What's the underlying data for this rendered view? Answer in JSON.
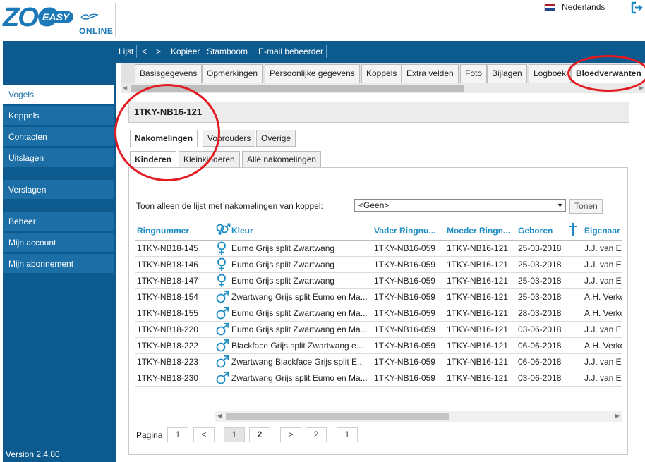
{
  "header": {
    "logo_zoo": "ZOO",
    "logo_easy": "EASY",
    "logo_online": "ONLINE",
    "language": "Nederlands"
  },
  "toolbar": [
    "Lijst",
    "<",
    ">",
    "Kopieer",
    "Stamboom",
    "E-mail beheerder"
  ],
  "sidebar": {
    "items": [
      "Vogels",
      "Koppels",
      "Contacten",
      "Uitslagen",
      "Verslagen",
      "Beheer",
      "Mijn account",
      "Mijn abonnement"
    ],
    "version": "Version 2.4.80"
  },
  "record_tabs": [
    "Basisgegevens",
    "Opmerkingen",
    "Persoonlijke gegevens",
    "Koppels",
    "Extra velden",
    "Foto",
    "Bijlagen",
    "Logboek",
    "Bloedverwanten"
  ],
  "record_title": "1TKY-NB16-121",
  "tabs_level1": [
    "Nakomelingen",
    "Voorouders",
    "Overige"
  ],
  "tabs_level2": [
    "Kinderen",
    "Kleinkinderen",
    "Alle nakomelingen"
  ],
  "filter": {
    "label": "Toon alleen de lijst met nakomelingen van koppel:",
    "value": "<Geen>",
    "button": "Tonen"
  },
  "table": {
    "headers": [
      "Ringnummer",
      "Kleur",
      "Vader Ringnu...",
      "Moeder Ringn...",
      "Geboren",
      "Eigenaar"
    ],
    "rows": [
      {
        "ring": "1TKY-NB18-145",
        "sex": "female",
        "kleur": "Eumo Grijs split Zwartwang",
        "vader": "1TKY-NB16-059",
        "moeder": "1TKY-NB16-121",
        "geboren": "25-03-2018",
        "eigenaar": "J.J. van Es"
      },
      {
        "ring": "1TKY-NB18-146",
        "sex": "female",
        "kleur": "Eumo Grijs split Zwartwang",
        "vader": "1TKY-NB16-059",
        "moeder": "1TKY-NB16-121",
        "geboren": "25-03-2018",
        "eigenaar": "J.J. van Es"
      },
      {
        "ring": "1TKY-NB18-147",
        "sex": "female",
        "kleur": "Eumo Grijs split Zwartwang",
        "vader": "1TKY-NB16-059",
        "moeder": "1TKY-NB16-121",
        "geboren": "25-03-2018",
        "eigenaar": "J.J. van Es"
      },
      {
        "ring": "1TKY-NB18-154",
        "sex": "male",
        "kleur": "Zwartwang Grijs split Eumo en Ma...",
        "vader": "1TKY-NB16-059",
        "moeder": "1TKY-NB16-121",
        "geboren": "25-03-2018",
        "eigenaar": "A.H. Verko"
      },
      {
        "ring": "1TKY-NB18-155",
        "sex": "male",
        "kleur": "Eumo Grijs split Zwartwang en Ma...",
        "vader": "1TKY-NB16-059",
        "moeder": "1TKY-NB16-121",
        "geboren": "28-03-2018",
        "eigenaar": "A.H. Verko"
      },
      {
        "ring": "1TKY-NB18-220",
        "sex": "male",
        "kleur": "Eumo Grijs split Zwartwang en Ma...",
        "vader": "1TKY-NB16-059",
        "moeder": "1TKY-NB16-121",
        "geboren": "03-06-2018",
        "eigenaar": "J.J. van Es"
      },
      {
        "ring": "1TKY-NB18-222",
        "sex": "male",
        "kleur": "Blackface Grijs split Zwartwang e...",
        "vader": "1TKY-NB16-059",
        "moeder": "1TKY-NB16-121",
        "geboren": "06-06-2018",
        "eigenaar": "A.H. Verko"
      },
      {
        "ring": "1TKY-NB18-223",
        "sex": "male",
        "kleur": "Zwartwang Blackface Grijs split E...",
        "vader": "1TKY-NB16-059",
        "moeder": "1TKY-NB16-121",
        "geboren": "06-06-2018",
        "eigenaar": "J.J. van Es"
      },
      {
        "ring": "1TKY-NB18-230",
        "sex": "male",
        "kleur": "Zwartwang Grijs split Eumo en Ma...",
        "vader": "1TKY-NB16-059",
        "moeder": "1TKY-NB16-121",
        "geboren": "03-06-2018",
        "eigenaar": "J.J. van Es"
      }
    ]
  },
  "pagination": {
    "label": "Pagina",
    "first": "1",
    "prev": "<",
    "current": "1",
    "next_page": "2",
    "next": ">",
    "last": "2",
    "page_size": "1"
  },
  "colors": {
    "sidebar": "#0d5a8f",
    "sidebar_item": "#1b6fa6",
    "accent": "#1b8dc4",
    "annotation": "#e21a22"
  }
}
